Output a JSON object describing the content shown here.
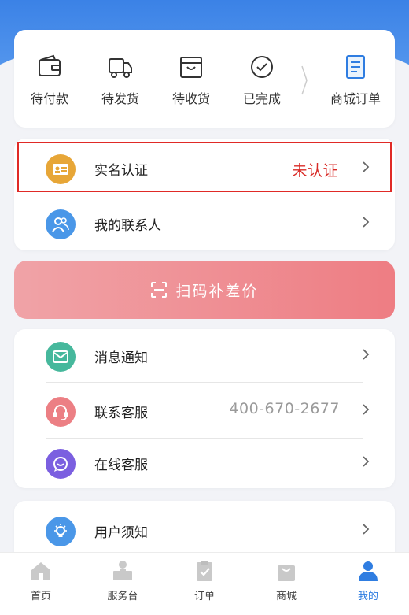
{
  "orders": {
    "items": [
      {
        "label": "待付款",
        "icon": "wallet-icon"
      },
      {
        "label": "待发货",
        "icon": "truck-icon"
      },
      {
        "label": "待收货",
        "icon": "box-icon"
      },
      {
        "label": "已完成",
        "icon": "check-circle-icon"
      },
      {
        "label": "商城订单",
        "icon": "document-icon"
      }
    ]
  },
  "menu_a": {
    "real_name": {
      "label": "实名认证",
      "status": "未认证",
      "icon": "id-card-icon"
    },
    "contacts": {
      "label": "我的联系人",
      "icon": "contacts-icon"
    }
  },
  "scan_button": {
    "label": "扫码补差价",
    "icon": "scan-icon"
  },
  "menu_b": {
    "messages": {
      "label": "消息通知",
      "icon": "mail-icon"
    },
    "service": {
      "label": "联系客服",
      "phone": "400-670-2677",
      "icon": "headset-icon"
    },
    "online": {
      "label": "在线客服",
      "icon": "chat-icon"
    }
  },
  "menu_c": {
    "notice": {
      "label": "用户须知",
      "icon": "lightbulb-icon"
    }
  },
  "tabbar": {
    "tabs": [
      {
        "label": "首页",
        "icon": "home-icon"
      },
      {
        "label": "服务台",
        "icon": "service-desk-icon"
      },
      {
        "label": "订单",
        "icon": "order-clipboard-icon"
      },
      {
        "label": "商城",
        "icon": "shopping-bag-icon"
      },
      {
        "label": "我的",
        "icon": "user-icon",
        "active": true
      }
    ]
  },
  "colors": {
    "accent_blue": "#2f7de1",
    "highlight_red": "#e02a26",
    "scan_gradient_start": "#f0a3a7",
    "scan_gradient_end": "#ee7d83"
  }
}
